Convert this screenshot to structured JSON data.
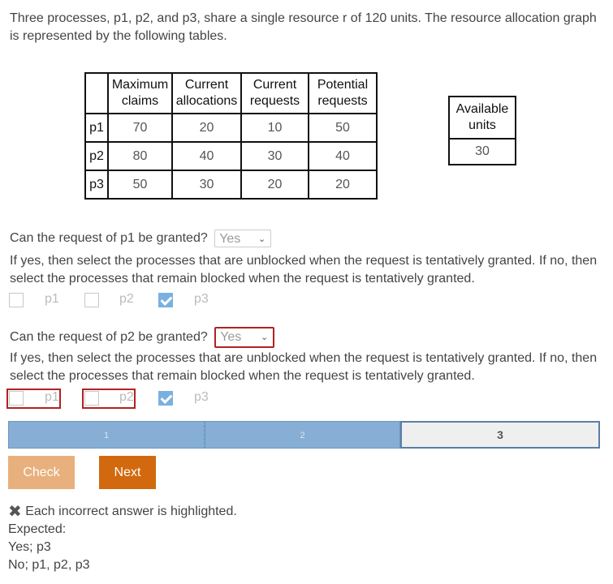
{
  "intro": "Three processes, p1, p2, and p3, share a single resource r of 120 units. The resource allocation graph is represented by the following tables.",
  "table": {
    "headers": [
      "Maximum claims",
      "Current allocations",
      "Current requests",
      "Potential requests"
    ],
    "header_lines": [
      [
        "Maximum",
        "claims"
      ],
      [
        "Current",
        "allocations"
      ],
      [
        "Current",
        "requests"
      ],
      [
        "Potential",
        "requests"
      ]
    ],
    "rows": [
      {
        "process": "p1",
        "values": [
          "70",
          "20",
          "10",
          "50"
        ]
      },
      {
        "process": "p2",
        "values": [
          "80",
          "40",
          "30",
          "40"
        ]
      },
      {
        "process": "p3",
        "values": [
          "50",
          "30",
          "20",
          "20"
        ]
      }
    ]
  },
  "available": {
    "header_lines": [
      "Available",
      "units"
    ],
    "value": "30"
  },
  "q1": {
    "question": "Can the request of p1 be granted?",
    "selected": "Yes",
    "instructions": "If yes, then select the processes that are unblocked when the request is tentatively granted. If no, then select the processes that remain blocked when the request is tentatively granted.",
    "options": [
      {
        "label": "p1",
        "checked": false
      },
      {
        "label": "p2",
        "checked": false
      },
      {
        "label": "p3",
        "checked": true
      }
    ]
  },
  "q2": {
    "question": "Can the request of p2 be granted?",
    "selected": "Yes",
    "instructions": "If yes, then select the processes that are unblocked when the request is tentatively granted. If no, then select the processes that remain blocked when the request is tentatively granted.",
    "options": [
      {
        "label": "p1",
        "checked": false
      },
      {
        "label": "p2",
        "checked": false
      },
      {
        "label": "p3",
        "checked": true
      }
    ]
  },
  "progress": {
    "steps": [
      "1",
      "2",
      "3"
    ],
    "current": 3
  },
  "buttons": {
    "check": "Check",
    "next": "Next"
  },
  "feedback": {
    "message": "Each incorrect answer is highlighted.",
    "expected_label": "Expected:",
    "expected": [
      "Yes; p3",
      "No; p1, p2, p3"
    ]
  },
  "colors": {
    "error": "#b22222",
    "progress": "#87aed4",
    "next": "#d2690e",
    "check": "#e8b07d"
  }
}
